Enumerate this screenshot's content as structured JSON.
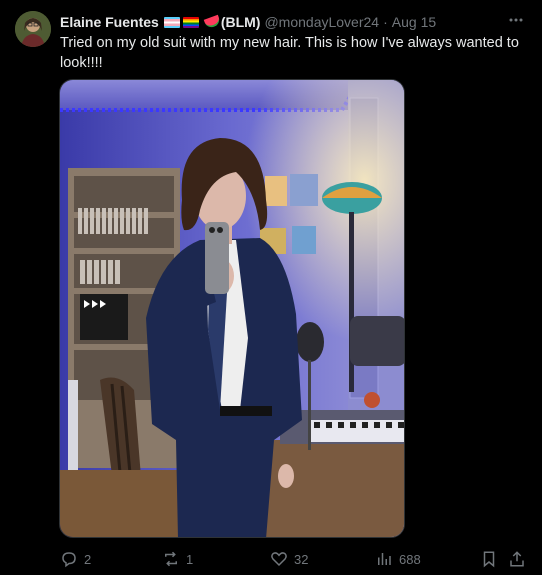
{
  "post": {
    "author_name": "Elaine Fuentes",
    "author_suffix": "(BLM)",
    "handle": "@mondayLover24",
    "dot": "·",
    "date": "Aug 15",
    "text": "Tried on my old suit with my new hair. This is how I've always wanted to look!!!!"
  },
  "flags": [
    "transgender-flag",
    "rainbow-flag",
    "watermelon"
  ],
  "actions": {
    "replies": "2",
    "reposts": "1",
    "likes": "32",
    "views": "688"
  },
  "colors": {
    "background": "#000000",
    "text_primary": "#e7e9ea",
    "text_secondary": "#71767b",
    "led_strip": "#3b38ff"
  },
  "icons": [
    "more-icon",
    "reply-icon",
    "repost-icon",
    "like-icon",
    "views-icon",
    "bookmark-icon",
    "share-icon"
  ]
}
